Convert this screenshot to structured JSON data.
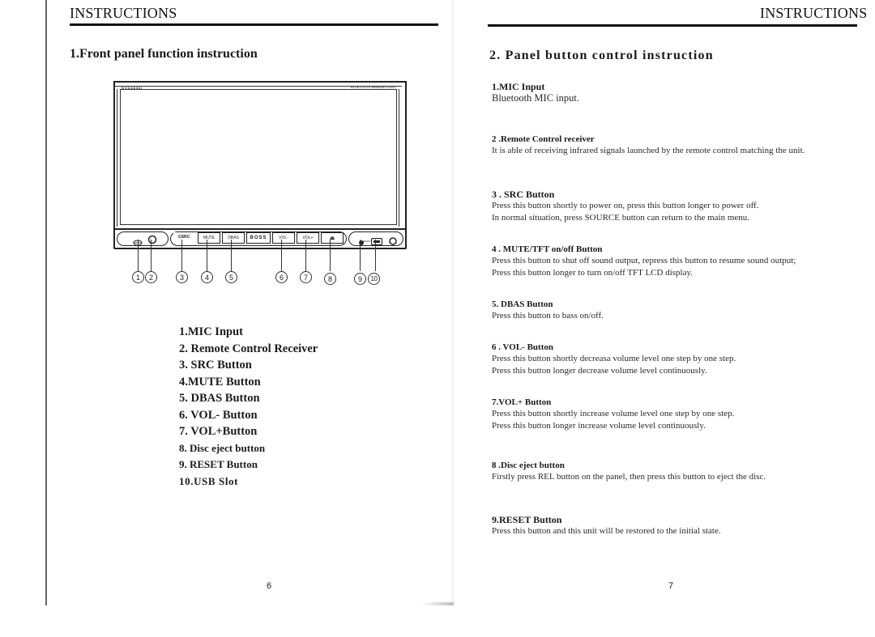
{
  "left_page": {
    "header": "INSTRUCTIONS",
    "section_title": "1.Front panel function instruction",
    "device": {
      "brand_text": "DVD8808I",
      "top_right_text": "BLUETOOTH  WMA/MP3  DIVX",
      "buttons": [
        {
          "id": "src",
          "label": "⏻SRC"
        },
        {
          "id": "mute",
          "label": "MUTE"
        },
        {
          "id": "dbas",
          "label": "DBAS"
        },
        {
          "id": "boss",
          "label": "BOSS"
        },
        {
          "id": "vol-minus",
          "label": "VOL-"
        },
        {
          "id": "vol-plus",
          "label": "VOL+"
        },
        {
          "id": "eject",
          "label": "⏏"
        }
      ],
      "reset_label": "RESET",
      "icons": {
        "mic": "mic-icon",
        "remote_receiver": "ir-receiver-icon",
        "reset": "reset-hole-icon",
        "usb": "usb-slot-icon",
        "knob": "knob-icon"
      },
      "callouts": [
        "1",
        "2",
        "3",
        "4",
        "5",
        "6",
        "7",
        "8",
        "9",
        "10"
      ]
    },
    "legend": [
      {
        "num": "1.",
        "label": "MIC Input"
      },
      {
        "num": "2.",
        "label": "Remote Control Receiver"
      },
      {
        "num": "3.",
        "label": "SRC Button"
      },
      {
        "num": "4.",
        "label": "MUTE Button"
      },
      {
        "num": "5.",
        "label": "DBAS Button"
      },
      {
        "num": "6.",
        "label": "VOL- Button"
      },
      {
        "num": "7.",
        "label": "VOL+Button"
      },
      {
        "num": "8.",
        "label": "Disc eject button"
      },
      {
        "num": "9.",
        "label": " RESET Button"
      },
      {
        "num": "10.",
        "label": "USB Slot"
      }
    ],
    "page_number": "6"
  },
  "right_page": {
    "header": "INSTRUCTIONS",
    "section_title": "2. Panel button control instruction",
    "items": [
      {
        "title": "1.MIC Input",
        "lines": [
          "Bluetooth MIC input."
        ]
      },
      {
        "title": "2 .Remote Control receiver",
        "lines": [
          "It is able of receiving infrared signals launched by the remote control matching the unit."
        ]
      },
      {
        "title": "3 . SRC Button",
        "lines": [
          "Press this button shortly to power on, press this button longer to power off.",
          "In normal situation, press SOURCE button can return to the main menu."
        ]
      },
      {
        "title": "4 . MUTE/TFT  on/off Button",
        "lines": [
          "Press this button to shut off sound output, repress this button to resume sound output;",
          "Press this button longer to turn on/off TFT LCD display."
        ]
      },
      {
        "title": "5. DBAS Button",
        "lines": [
          "Press this button to bass on/off."
        ]
      },
      {
        "title": "6 . VOL- Button",
        "lines": [
          "Press this button shortly decreasa volume level one step by one step.",
          "Press this button longer decrease volume level continuously."
        ]
      },
      {
        "title": "7.VOL+ Button",
        "lines": [
          "Press this button shortly increase volume level one step by one step.",
          "Press this button longer increase volume level continuously."
        ]
      },
      {
        "title": "8 .Disc eject button",
        "lines": [
          "Firstly press REL button on the panel, then press this button to eject the disc."
        ]
      },
      {
        "title": "9.RESET Button",
        "lines": [
          "Press this button and this unit will be restored to the initial state."
        ]
      }
    ],
    "page_number": "7"
  }
}
